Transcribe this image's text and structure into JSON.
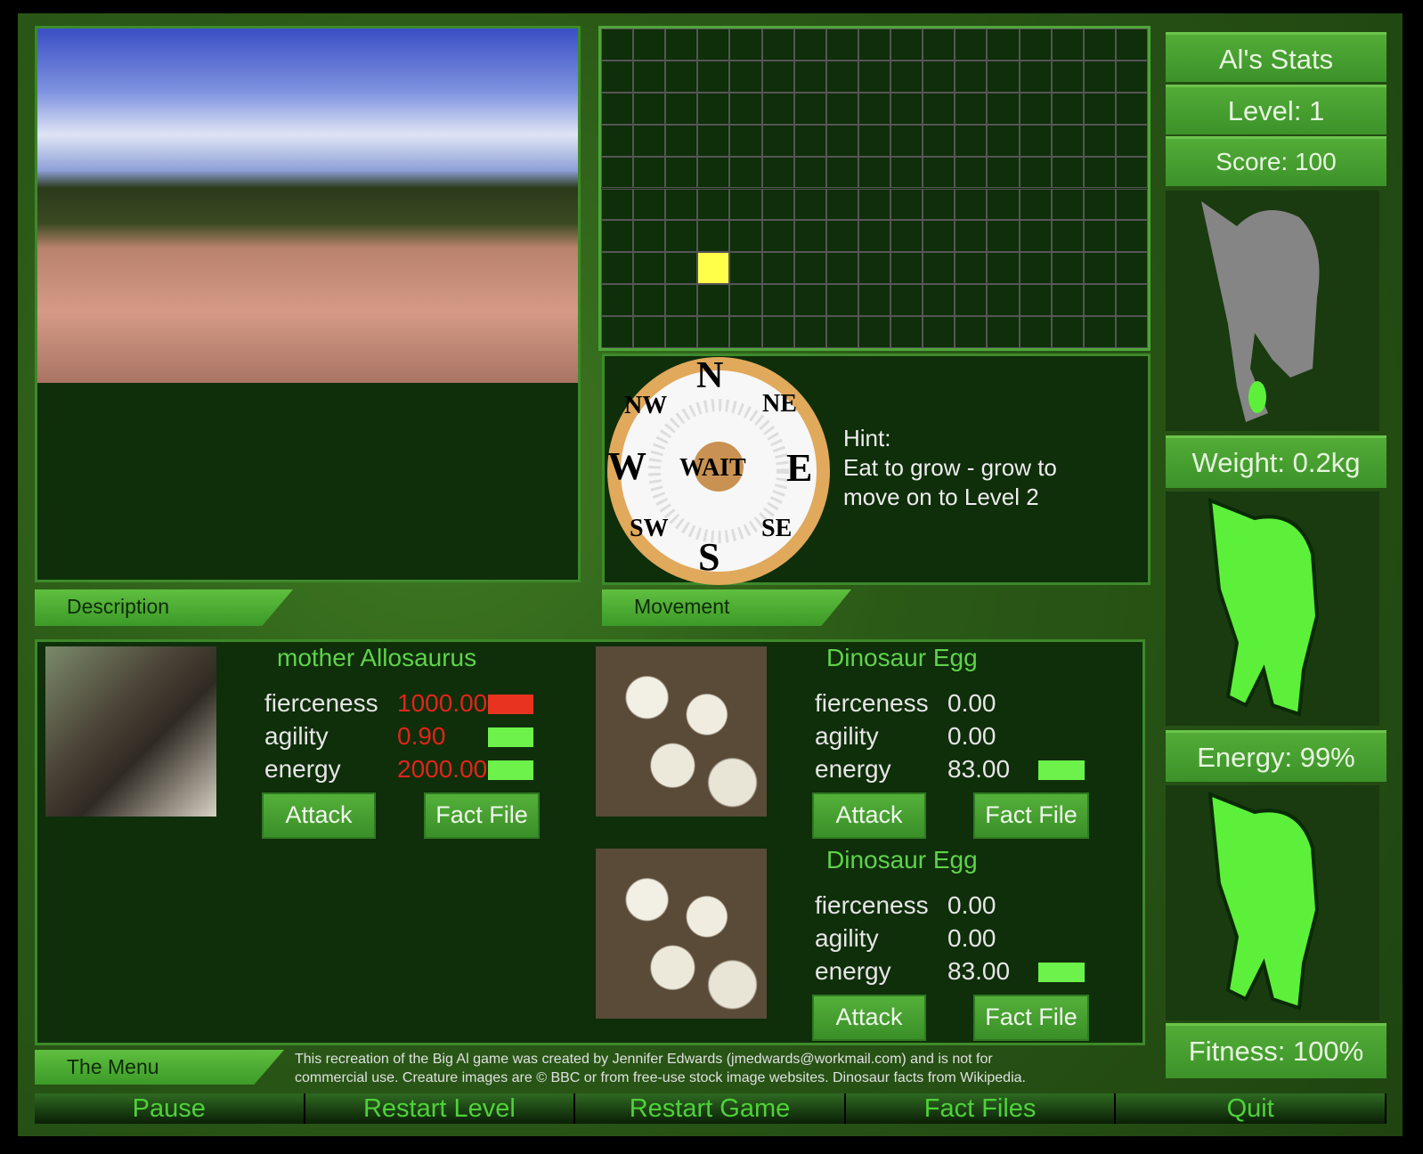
{
  "panels": {
    "description_tab": "Description",
    "movement_tab": "Movement",
    "menu_tab": "The Menu"
  },
  "map": {
    "cols": 17,
    "rows": 10,
    "player": {
      "col": 3,
      "row": 7
    },
    "player_color": "#ffff4a",
    "cell_bg": "#0f2e0a"
  },
  "compass": {
    "n": "N",
    "ne": "NE",
    "e": "E",
    "se": "SE",
    "s": "S",
    "sw": "SW",
    "w": "W",
    "nw": "NW",
    "wait": "WAIT"
  },
  "hint": {
    "title": "Hint:",
    "line1": "Eat to grow - grow to",
    "line2": "move on to Level 2"
  },
  "stats": {
    "title": "Al's Stats",
    "level": "Level: 1",
    "score": "Score: 100",
    "weight": "Weight: 0.2kg",
    "energy": "Energy: 99%",
    "fitness": "Fitness: 100%"
  },
  "creatures": [
    {
      "name": "mother Allosaurus",
      "fierceness": "1000.00",
      "agility": "0.90",
      "energy": "2000.00",
      "bars": {
        "fierceness": "#e8331f",
        "agility": "#6cf24a",
        "energy": "#6cf24a"
      },
      "attack": "Attack",
      "fact": "Fact File"
    },
    {
      "name": "Dinosaur Egg",
      "fierceness": "0.00",
      "agility": "0.00",
      "energy": "83.00",
      "attack": "Attack",
      "fact": "Fact File"
    },
    {
      "name": "Dinosaur Egg",
      "fierceness": "0.00",
      "agility": "0.00",
      "energy": "83.00",
      "attack": "Attack",
      "fact": "Fact File"
    }
  ],
  "stat_labels": {
    "fierceness": "fierceness",
    "agility": "agility",
    "energy": "energy"
  },
  "credits": {
    "line1": "This recreation of the Big Al game was created by Jennifer Edwards (jmedwards@workmail.com) and is not for",
    "line2": "commercial use. Creature images are © BBC or from free-use stock image websites. Dinosaur facts from Wikipedia."
  },
  "nav": [
    "Pause",
    "Restart Level",
    "Restart Game",
    "Fact Files",
    "Quit"
  ]
}
